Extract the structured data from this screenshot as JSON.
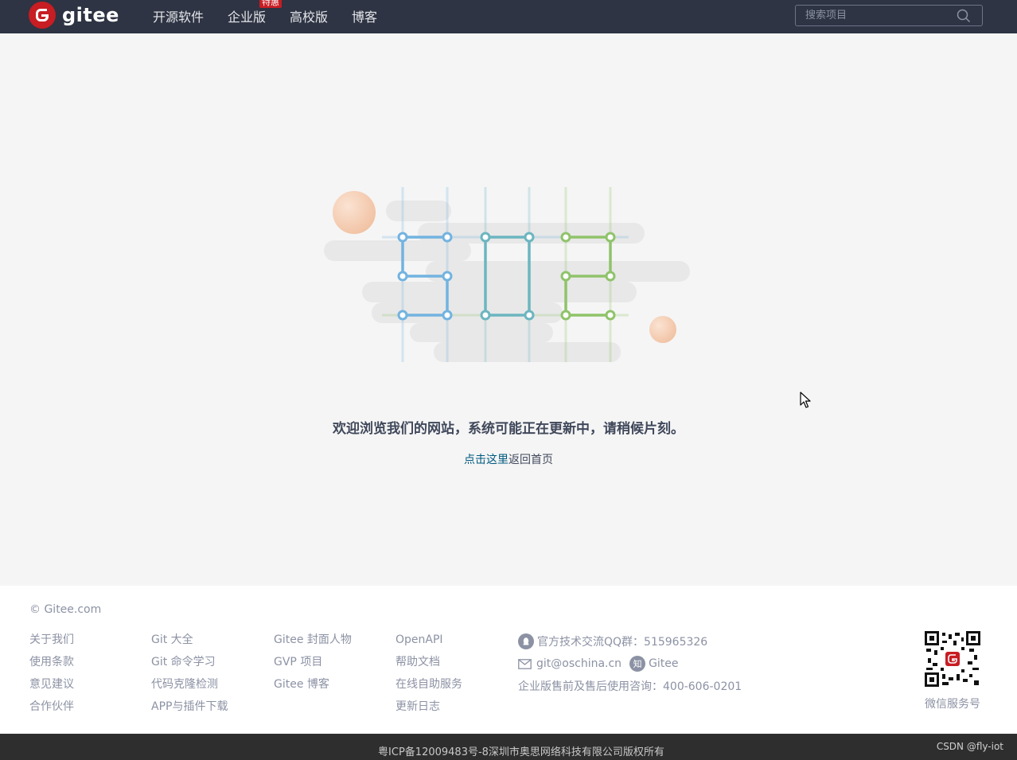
{
  "header": {
    "logo_text": "gitee",
    "nav": [
      {
        "label": "开源软件"
      },
      {
        "label": "企业版",
        "badge": "特惠"
      },
      {
        "label": "高校版"
      },
      {
        "label": "博客"
      }
    ],
    "search_placeholder": "搜索项目"
  },
  "main": {
    "illustration_code": "502",
    "message": "欢迎浏览我们的网站，系统可能正在更新中，请稍候片刻。",
    "back_link": "点击这里",
    "back_text": "返回首页"
  },
  "footer": {
    "copyright": "© Gitee.com",
    "col1": [
      "关于我们",
      "使用条款",
      "意见建议",
      "合作伙伴"
    ],
    "col2": [
      "Git 大全",
      "Git 命令学习",
      "代码克隆检测",
      "APP与插件下载"
    ],
    "col3": [
      "Gitee 封面人物",
      "GVP 项目",
      "Gitee 博客"
    ],
    "col4": [
      "OpenAPI",
      "帮助文档",
      "在线自助服务",
      "更新日志"
    ],
    "qq_group": "官方技术交流QQ群：515965326",
    "email": "git@oschina.cn",
    "zhihu_icon_text": "知",
    "zhihu": "Gitee",
    "hotline": "企业版售前及售后使用咨询：400-606-0201",
    "qr_label": "微信服务号",
    "icp": "粤ICP备12009483号-8深圳市奥思网络科技有限公司版权所有",
    "watermark": "CSDN @fly-iot"
  },
  "colors": {
    "brand": "#c71d23",
    "header_bg": "#2e3443",
    "link": "#005980"
  }
}
